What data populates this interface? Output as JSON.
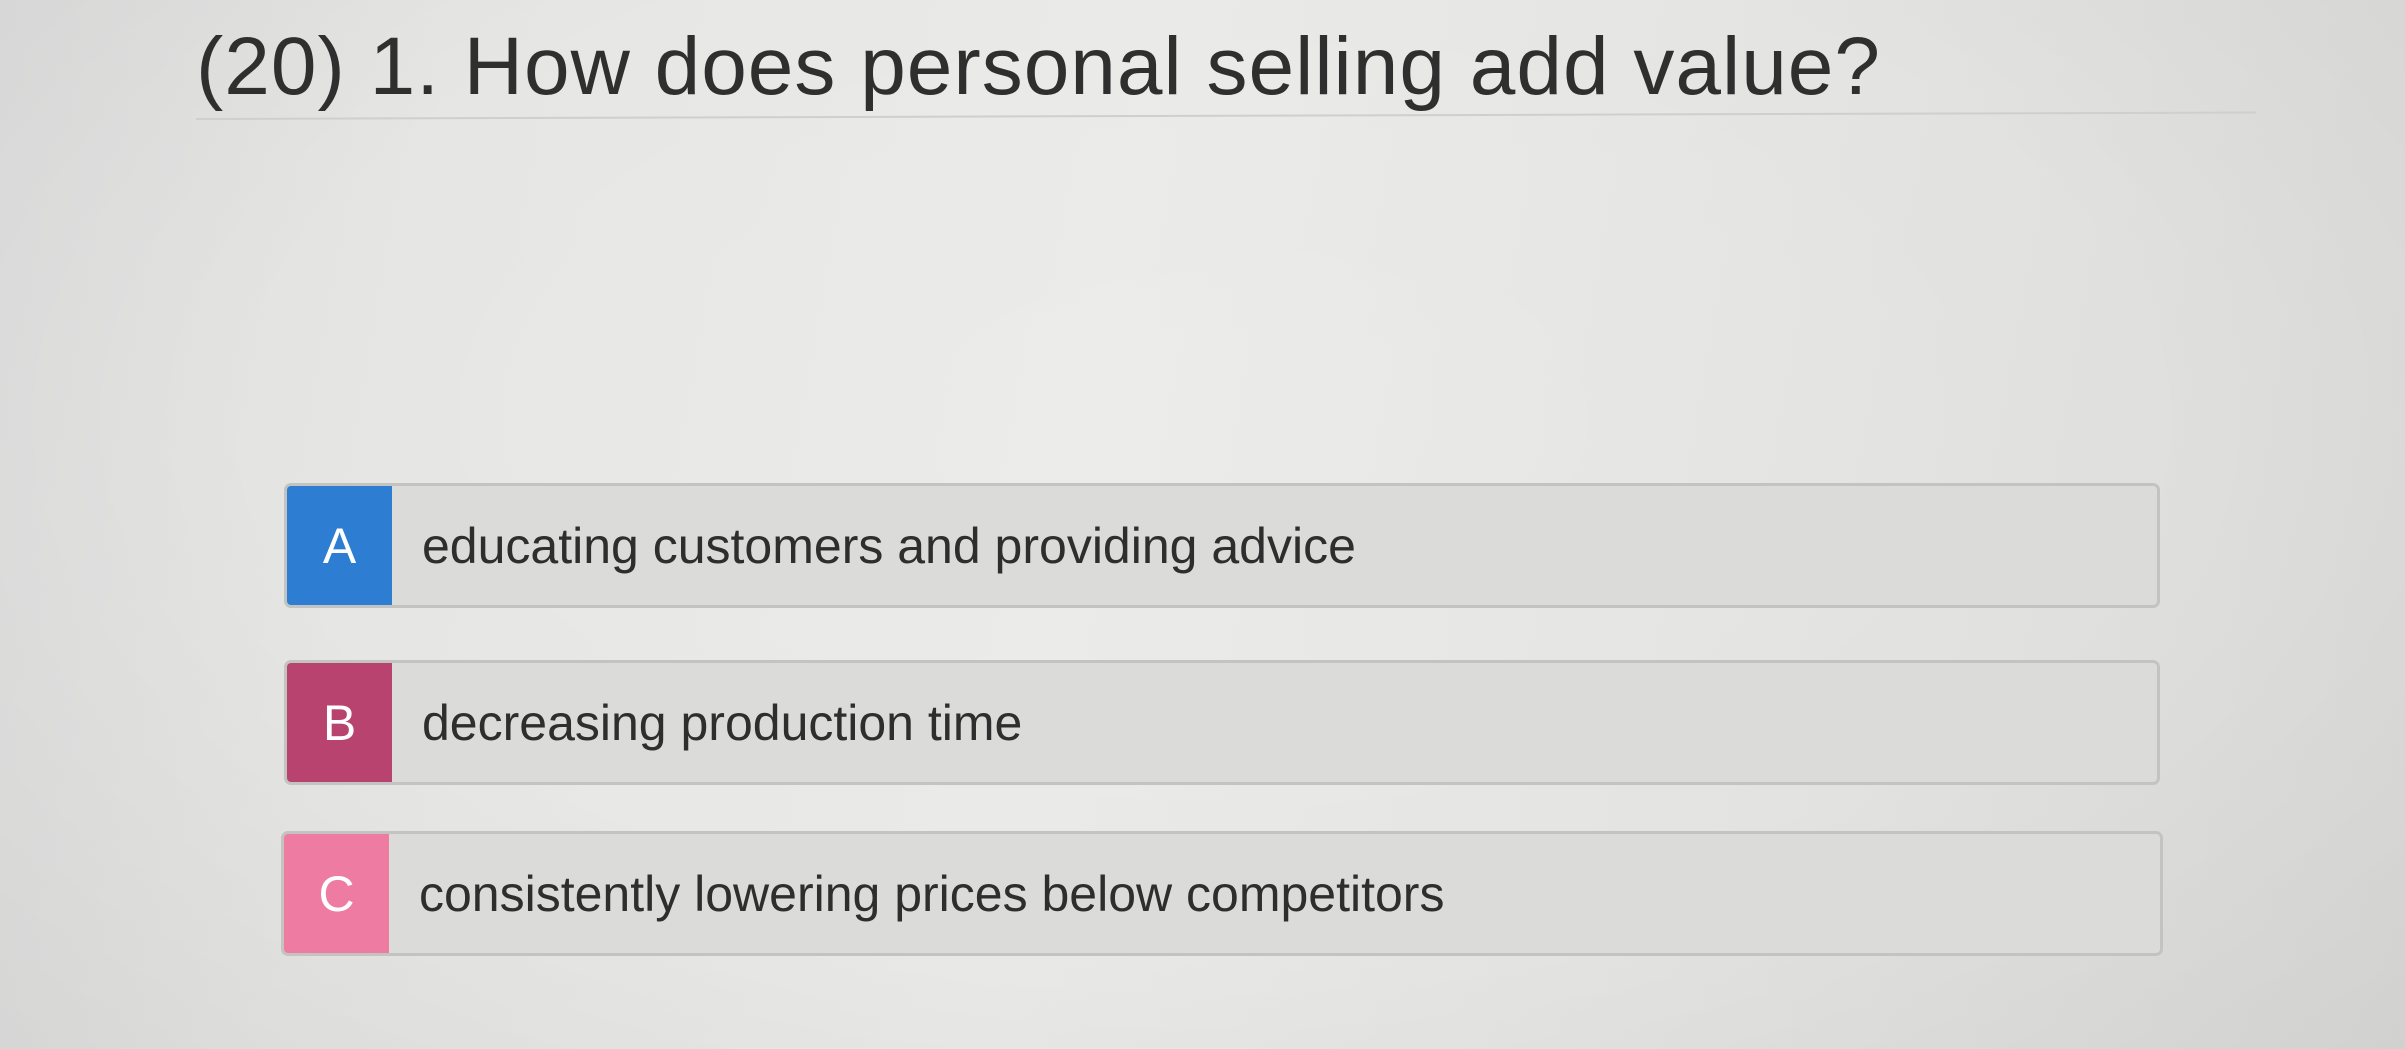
{
  "question": {
    "title": "(20) 1. How does personal selling add value?"
  },
  "options": [
    {
      "letter": "A",
      "text": "educating customers and providing advice",
      "color": "#2d7dd2"
    },
    {
      "letter": "B",
      "text": "decreasing production time",
      "color": "#b8436e"
    },
    {
      "letter": "C",
      "text": "consistently lowering prices below competitors",
      "color": "#ee7ba2"
    }
  ]
}
